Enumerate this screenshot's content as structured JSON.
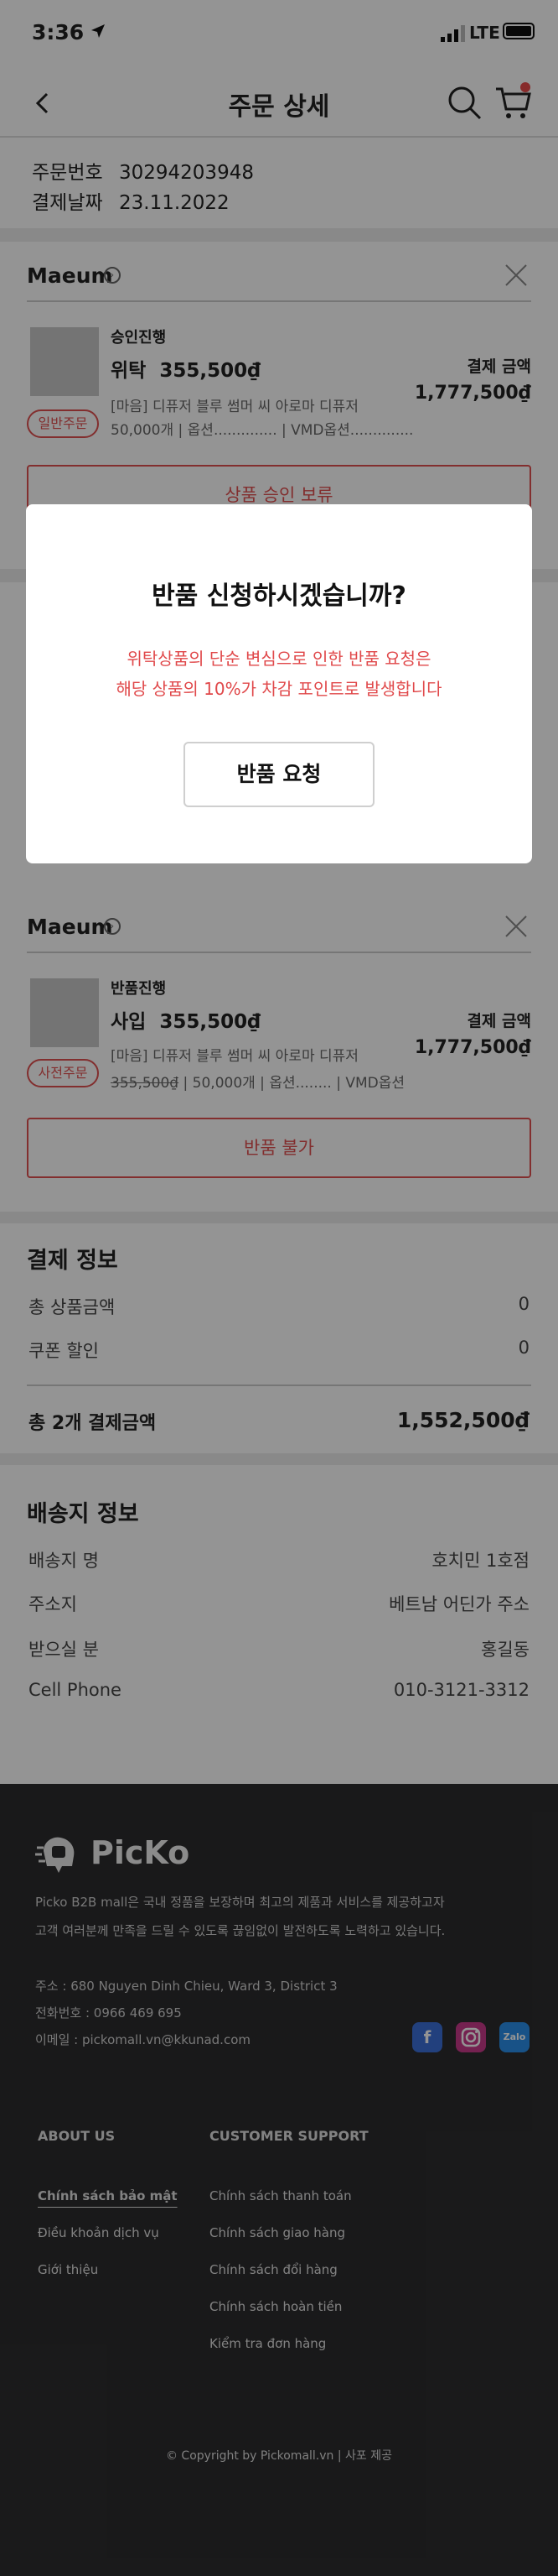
{
  "status_bar": {
    "time": "3:36",
    "network": "LTE"
  },
  "header": {
    "title": "주문 상세"
  },
  "order": {
    "number_label": "주문번호",
    "number": "30294203948",
    "date_label": "결제날짜",
    "date": "23.11.2022"
  },
  "items": [
    {
      "store": "Maeum",
      "status": "승인진행",
      "type": "위탁",
      "price": "355,500₫",
      "detail1": "[마음] 디퓨저 블루 썸머 씨 아로마 디퓨저",
      "detail2": "50,000개 | 옵션.............. | VMD옵션..............",
      "pay_label": "결제 금액",
      "pay_value": "1,777,500₫",
      "badge": "일반주문",
      "button": "상품 승인 보류"
    },
    {
      "store": "Maeum",
      "status": "반품진행",
      "type": "사입",
      "price": "355,500₫",
      "detail1": "[마음] 디퓨저 블루 썸머 씨 아로마 디퓨저",
      "detail2_strike": "355,500₫",
      "detail2": " | 50,000개 | 옵션........ | VMD옵션",
      "pay_label": "결제 금액",
      "pay_value": "1,777,500₫",
      "badge": "사전주문",
      "button": "반품 불가"
    }
  ],
  "payment": {
    "title": "결제 정보",
    "rows": [
      {
        "label": "총 상품금액",
        "value": "0"
      },
      {
        "label": "쿠폰 할인",
        "value": "0"
      }
    ],
    "total_label": "총 2개 결제금액",
    "total_value": "1,552,500₫"
  },
  "shipping": {
    "title": "배송지 정보",
    "rows": [
      {
        "label": "배송지 명",
        "value": "호치민 1호점"
      },
      {
        "label": "주소지",
        "value": "베트남 어딘가 주소"
      },
      {
        "label": "받으실 분",
        "value": "홍길동"
      },
      {
        "label": "Cell Phone",
        "value": "010-3121-3312"
      }
    ]
  },
  "footer": {
    "brand": "PicKo",
    "desc1": "Picko B2B mall은 국내 정품을 보장하며 최고의 제품과 서비스를 제공하고자",
    "desc2": "고객 여러분께 만족을 드릴 수 있도록 끊임없이 발전하도록 노력하고 있습니다.",
    "address": "주소 : 680 Nguyen Dinh Chieu, Ward 3, District 3",
    "phone": "전화번호 : 0966 469 695",
    "email": "이메일 : pickomall.vn@kkunad.com",
    "about_title": "ABOUT US",
    "about_links": [
      "Chính sách bảo mật",
      "Điều khoản dịch vụ",
      "Giới thiệu"
    ],
    "support_title": "CUSTOMER SUPPORT",
    "support_links": [
      "Chính sách thanh toán",
      "Chính sách giao hàng",
      "Chính sách đổi hàng",
      "Chính sách hoàn tiền",
      "Kiểm tra đơn hàng"
    ],
    "copyright": "© Copyright by Pickomall.vn | 사포 제공",
    "social": {
      "zalo": "Zalo"
    }
  },
  "modal": {
    "title": "반품 신청하시겠습니까?",
    "line1": "위탁상품의 단순 변심으로 인한 반품 요청은",
    "line2": "해당 상품의 10%가 차감 포인트로 발생합니다",
    "button": "반품 요청"
  },
  "colors": {
    "accent": "#e05050",
    "cart_dot": "#e84b4b",
    "footer_bg": "#2c2c2e",
    "facebook": "#3b6fd8",
    "instagram": "#c93a8a",
    "zalo": "#2a8ee8"
  }
}
